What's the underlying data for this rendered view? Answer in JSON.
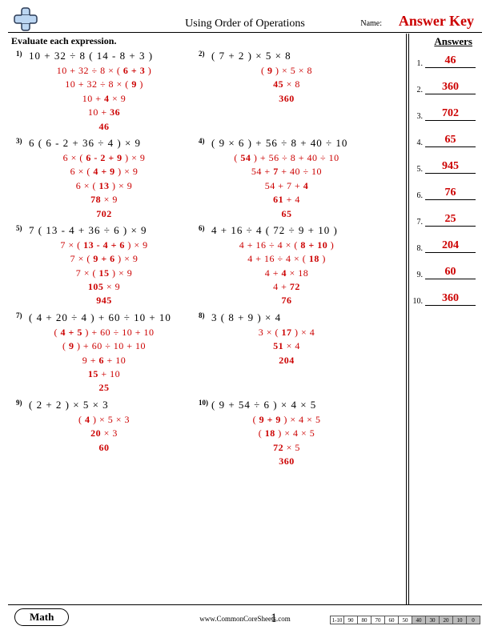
{
  "header": {
    "title": "Using Order of Operations",
    "name_label": "Name:",
    "answer_key": "Answer Key"
  },
  "instruction": "Evaluate each expression.",
  "answers_title": "Answers",
  "problems": [
    {
      "num": "1)",
      "expr": "10 + 32 ÷ 8 ( 14 - 8 + 3 )",
      "steps": [
        "10 + 32 ÷ 8 × ( <b>6 + 3</b> )",
        "10 + 32 ÷ 8 × ( <b>9</b> )",
        "10 + <b>4</b> × 9",
        "10 + <b>36</b>",
        "<b>46</b>"
      ]
    },
    {
      "num": "2)",
      "expr": "( 7 + 2 ) × 5 × 8",
      "steps": [
        "( <b>9</b> ) × 5 × 8",
        "<b>45</b> × 8",
        "<b>360</b>"
      ]
    },
    {
      "num": "3)",
      "expr": "6 ( 6 - 2 + 36 ÷ 4 ) × 9",
      "steps": [
        "6 × ( <b>6 - 2 + 9</b> ) × 9",
        "6 × ( <b>4 + 9</b> ) × 9",
        "6 × ( <b>13</b> ) × 9",
        "<b>78</b> × 9",
        "<b>702</b>"
      ]
    },
    {
      "num": "4)",
      "expr": "( 9 × 6 ) + 56 ÷ 8 + 40 ÷ 10",
      "steps": [
        "( <b>54</b> ) + 56 ÷ 8 + 40 ÷ 10",
        "54 + <b>7</b> + 40 ÷ 10",
        "54 + 7 + <b>4</b>",
        "<b>61</b> + 4",
        "<b>65</b>"
      ]
    },
    {
      "num": "5)",
      "expr": "7 ( 13 - 4 + 36 ÷ 6 ) × 9",
      "steps": [
        "7 × ( <b>13 - 4 + 6</b> ) × 9",
        "7 × ( <b>9 + 6</b> ) × 9",
        "7 × ( <b>15</b> ) × 9",
        "<b>105</b> × 9",
        "<b>945</b>"
      ]
    },
    {
      "num": "6)",
      "expr": "4 + 16 ÷ 4 ( 72 ÷ 9 + 10 )",
      "steps": [
        "4 + 16 ÷ 4 × ( <b>8 + 10</b> )",
        "4 + 16 ÷ 4 × ( <b>18</b> )",
        "4 + <b>4</b> × 18",
        "4 + <b>72</b>",
        "<b>76</b>"
      ]
    },
    {
      "num": "7)",
      "expr": "( 4 + 20 ÷ 4 ) + 60 ÷ 10 + 10",
      "steps": [
        "( <b>4 + 5</b> ) + 60 ÷ 10 + 10",
        "( <b>9</b> ) + 60 ÷ 10 + 10",
        "9 + <b>6</b> + 10",
        "<b>15</b> + 10",
        "<b>25</b>"
      ]
    },
    {
      "num": "8)",
      "expr": "3 ( 8 + 9 ) × 4",
      "steps": [
        "3 × ( <b>17</b> ) × 4",
        "<b>51</b> × 4",
        "<b>204</b>"
      ]
    },
    {
      "num": "9)",
      "expr": "( 2 + 2 ) × 5 × 3",
      "steps": [
        "( <b>4</b> ) × 5 × 3",
        "<b>20</b> × 3",
        "<b>60</b>"
      ]
    },
    {
      "num": "10)",
      "expr": "( 9 + 54 ÷ 6 ) × 4 × 5",
      "steps": [
        "( <b>9 + 9</b> ) × 4 × 5",
        "( <b>18</b> ) × 4 × 5",
        "<b>72</b> × 5",
        "<b>360</b>"
      ]
    }
  ],
  "answers": [
    "46",
    "360",
    "702",
    "65",
    "945",
    "76",
    "25",
    "204",
    "60",
    "360"
  ],
  "footer": {
    "subject": "Math",
    "url": "www.CommonCoreSheets.com",
    "page": "1"
  },
  "score": {
    "header": [
      "1-10",
      "90",
      "80",
      "70",
      "60",
      "50",
      "40",
      "30",
      "20",
      "10",
      "0"
    ]
  }
}
